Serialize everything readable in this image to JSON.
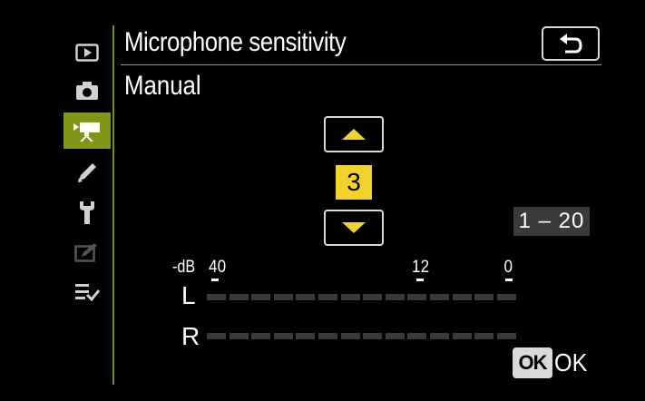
{
  "header": {
    "title": "Microphone sensitivity",
    "subtitle": "Manual"
  },
  "sidebar": {
    "items": [
      {
        "icon": "playback-icon",
        "active": false
      },
      {
        "icon": "camera-icon",
        "active": false
      },
      {
        "icon": "movie-camera-icon",
        "active": true
      },
      {
        "icon": "pencil-icon",
        "active": false
      },
      {
        "icon": "wrench-icon",
        "active": false
      },
      {
        "icon": "retouch-icon",
        "active": false
      },
      {
        "icon": "my-menu-icon",
        "active": false
      }
    ]
  },
  "control": {
    "value": "3",
    "range": "1 – 20"
  },
  "meter": {
    "db_label": "-dB",
    "scale": [
      "40",
      "12",
      "0"
    ],
    "channels": [
      "L",
      "R"
    ],
    "level_left": 0,
    "level_right": 0
  },
  "footer": {
    "ok_badge": "OK",
    "ok_label": "OK"
  },
  "colors": {
    "accent": "#7f9619",
    "value_highlight": "#f3d22c"
  }
}
